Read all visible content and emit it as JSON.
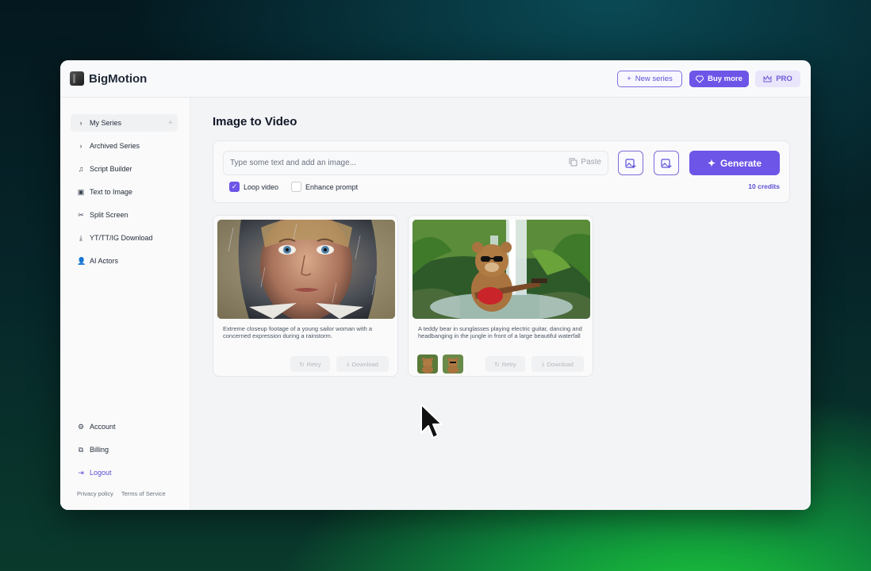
{
  "app": {
    "name": "BigMotion"
  },
  "topbar": {
    "new_series": "New series",
    "buy_more": "Buy more",
    "pro": "PRO"
  },
  "sidebar": {
    "items": [
      {
        "label": "My Series",
        "icon": "chevron-right-icon"
      },
      {
        "label": "Archived Series",
        "icon": "chevron-right-icon"
      },
      {
        "label": "Script Builder",
        "icon": "script-icon"
      },
      {
        "label": "Text to Image",
        "icon": "image-icon"
      },
      {
        "label": "Split Screen",
        "icon": "scissors-icon"
      },
      {
        "label": "YT/TT/IG Download",
        "icon": "download-icon"
      },
      {
        "label": "AI Actors",
        "icon": "user-plus-icon"
      }
    ],
    "bottom": [
      {
        "label": "Account",
        "icon": "gear-icon"
      },
      {
        "label": "Billing",
        "icon": "billing-icon"
      },
      {
        "label": "Logout",
        "icon": "logout-icon"
      }
    ],
    "footer": {
      "privacy": "Privacy policy",
      "terms": "Terms of Service"
    }
  },
  "main": {
    "title": "Image to Video",
    "prompt": {
      "placeholder": "Type some text and add an image...",
      "paste": "Paste",
      "generate": "Generate",
      "credits": "10 credits",
      "loop_video": "Loop video",
      "loop_checked": true,
      "enhance_prompt": "Enhance prompt",
      "enhance_checked": false
    },
    "videos": [
      {
        "caption": "Extreme closeup footage of a young sailor woman with a concerned expression during a rainstorm.",
        "retry": "Retry",
        "download": "Download"
      },
      {
        "caption": "A teddy bear in sunglasses playing electric guitar, dancing and headbanging in the jungle in front of a large beautiful waterfall",
        "retry": "Retry",
        "download": "Download"
      }
    ]
  },
  "colors": {
    "accent": "#6d55e8",
    "accent_light": "#e9e5fb"
  }
}
